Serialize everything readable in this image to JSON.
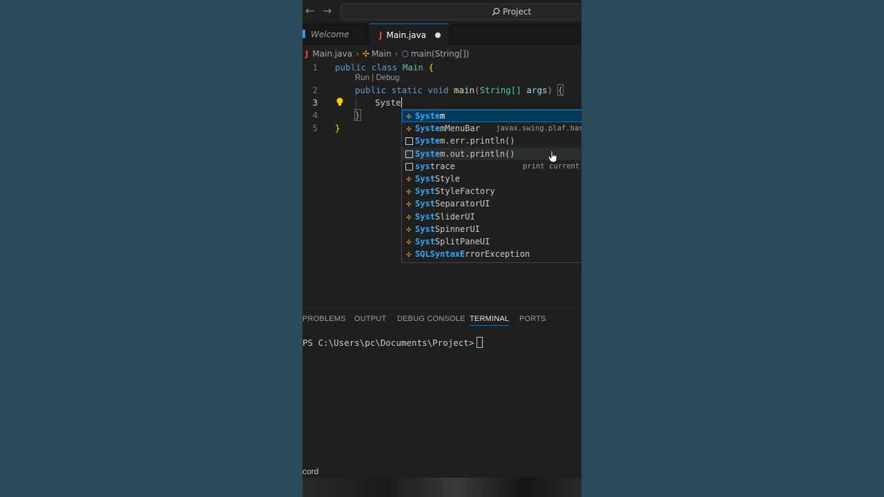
{
  "titlebar": {
    "search_label": "Project"
  },
  "tabs": [
    {
      "label": "Welcome"
    },
    {
      "label": "Main.java",
      "icon": "J"
    }
  ],
  "breadcrumb": {
    "file": "Main.java",
    "class": "Main",
    "method": "main(String[])"
  },
  "editor": {
    "line_numbers": [
      "1",
      "2",
      "3",
      "4",
      "5"
    ],
    "line1": {
      "kw1": "public",
      "kw2": "class",
      "name": "Main",
      "brace": "{"
    },
    "codelens": "Run | Debug",
    "line2": {
      "kw1": "public",
      "kw2": "static",
      "kw3": "void",
      "fn": "main",
      "open": "(",
      "type": "String[]",
      "arg": "args",
      "close": ")",
      "brace": "{"
    },
    "line3": {
      "typed": "Syste"
    },
    "line4": {
      "brace": "}"
    },
    "line5": {
      "brace": "}"
    }
  },
  "suggestions": [
    {
      "match": "Syste",
      "rest": "m",
      "kind": "class",
      "detail": ""
    },
    {
      "match": "Syste",
      "rest": "mMenuBar",
      "kind": "class",
      "detail": "javax.swing.plaf.bas"
    },
    {
      "match": "Syste",
      "rest": "m.err.println()",
      "kind": "snippet",
      "detail": ""
    },
    {
      "match": "Syste",
      "rest": "m.out.println()",
      "kind": "snippet",
      "detail": ""
    },
    {
      "prefix": "sys",
      "match": "t",
      "rest": "race",
      "kind": "snippet",
      "detail": "print current"
    },
    {
      "match": "Syst",
      "rest": "Style",
      "kind": "class",
      "detail": ""
    },
    {
      "match": "Syst",
      "rest": "StyleFactory",
      "kind": "class",
      "detail": ""
    },
    {
      "match": "Syst",
      "rest": "SeparatorUI",
      "kind": "class",
      "detail": ""
    },
    {
      "match": "Syst",
      "rest": "SliderUI",
      "kind": "class",
      "detail": ""
    },
    {
      "match": "Syst",
      "rest": "SpinnerUI",
      "kind": "class",
      "detail": ""
    },
    {
      "match": "Syst",
      "rest": "SplitPaneUI",
      "kind": "class",
      "detail": ""
    },
    {
      "match": "SQLSyntaxE",
      "rest": "rrorException",
      "kind": "class",
      "detail": ""
    }
  ],
  "panel": {
    "tabs": [
      "PROBLEMS",
      "OUTPUT",
      "DEBUG CONSOLE",
      "TERMINAL",
      "PORTS"
    ],
    "active_tab": "TERMINAL",
    "prompt": "PS C:\\Users\\pc\\Documents\\Project>"
  },
  "status": {
    "text": "cord"
  },
  "colors": {
    "accent": "#0078d4",
    "match": "#2aaaff",
    "keyword": "#569cd6",
    "class": "#4ec9b0"
  }
}
